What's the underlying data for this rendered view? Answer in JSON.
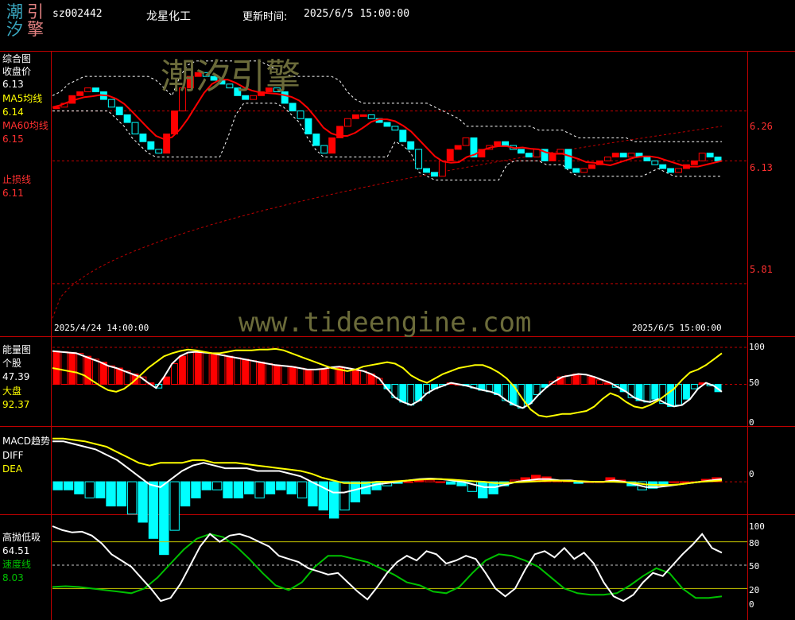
{
  "header": {
    "logo_chars": [
      "潮",
      "引",
      "汐",
      "擎"
    ],
    "code": "sz002442",
    "name": "龙星化工",
    "update_label": "更新时间:",
    "update_time": "2025/6/5 15:00:00"
  },
  "watermarks": {
    "brand": "潮汐引擎",
    "url": "www.tideengine.com"
  },
  "colors": {
    "background": "#000000",
    "border": "#c00000",
    "up": "#ff0000",
    "down": "#00ffff",
    "yellow": "#ffff00",
    "green": "#00c000"
  },
  "chart_data": [
    {
      "id": "composite",
      "type": "candlestick",
      "title": "综合图",
      "labels": {
        "close_label": "收盘价",
        "close_value": "6.13",
        "ma5_label": "MA5均线",
        "ma5_value": "6.14",
        "ma60_label": "MA60均线",
        "ma60_value": "6.15",
        "stop_label": "止损线",
        "stop_value": "6.11"
      },
      "date_start": "2025/4/24 14:00:00",
      "date_end": "2025/6/5 15:00:00",
      "y_ticks": [
        "6.26",
        "6.13",
        "5.81"
      ],
      "ylim": [
        5.7,
        6.4
      ],
      "closes": [
        6.27,
        6.28,
        6.3,
        6.31,
        6.32,
        6.31,
        6.29,
        6.27,
        6.25,
        6.23,
        6.2,
        6.18,
        6.16,
        6.15,
        6.2,
        6.26,
        6.32,
        6.35,
        6.36,
        6.35,
        6.34,
        6.33,
        6.32,
        6.3,
        6.29,
        6.3,
        6.31,
        6.32,
        6.31,
        6.28,
        6.26,
        6.24,
        6.2,
        6.17,
        6.15,
        6.19,
        6.22,
        6.24,
        6.25,
        6.25,
        6.24,
        6.23,
        6.22,
        6.21,
        6.18,
        6.16,
        6.11,
        6.1,
        6.09,
        6.13,
        6.16,
        6.17,
        6.19,
        6.14,
        6.16,
        6.17,
        6.18,
        6.17,
        6.16,
        6.15,
        6.14,
        6.16,
        6.13,
        6.15,
        6.16,
        6.11,
        6.1,
        6.11,
        6.12,
        6.13,
        6.14,
        6.15,
        6.14,
        6.15,
        6.14,
        6.13,
        6.12,
        6.11,
        6.1,
        6.11,
        6.12,
        6.13,
        6.15,
        6.14,
        6.13
      ]
    },
    {
      "id": "energy",
      "type": "bar+line",
      "title": "能量图",
      "stock_label": "个股",
      "stock_value": "47.39",
      "market_label": "大盘",
      "market_value": "92.37",
      "y_ticks": [
        "100",
        "50",
        "0"
      ],
      "ylim": [
        0,
        100
      ],
      "series": [
        {
          "name": "个股",
          "values": [
            95,
            94,
            93,
            92,
            88,
            84,
            80,
            75,
            72,
            68,
            64,
            60,
            52,
            45,
            60,
            78,
            88,
            93,
            94,
            93,
            92,
            90,
            88,
            86,
            84,
            82,
            80,
            78,
            76,
            75,
            74,
            72,
            70,
            70,
            71,
            73,
            74,
            72,
            70,
            68,
            64,
            58,
            44,
            32,
            26,
            22,
            28,
            38,
            44,
            48,
            52,
            50,
            48,
            45,
            42,
            40,
            36,
            28,
            22,
            18,
            24,
            36,
            46,
            54,
            60,
            62,
            64,
            63,
            60,
            56,
            52,
            46,
            40,
            32,
            28,
            26,
            30,
            24,
            20,
            22,
            30,
            44,
            52,
            48,
            40
          ]
        },
        {
          "name": "大盘",
          "values": [
            72,
            70,
            68,
            66,
            62,
            55,
            48,
            42,
            40,
            44,
            52,
            62,
            72,
            80,
            88,
            92,
            95,
            97,
            96,
            94,
            92,
            92,
            94,
            96,
            96,
            96,
            97,
            97,
            98,
            96,
            92,
            88,
            84,
            80,
            76,
            72,
            70,
            68,
            70,
            74,
            76,
            78,
            80,
            78,
            72,
            62,
            56,
            52,
            58,
            64,
            68,
            72,
            74,
            76,
            76,
            72,
            66,
            58,
            46,
            30,
            16,
            8,
            6,
            8,
            10,
            10,
            12,
            14,
            20,
            30,
            38,
            34,
            26,
            20,
            18,
            22,
            28,
            36,
            44,
            56,
            66,
            70,
            76,
            84,
            92
          ]
        }
      ]
    },
    {
      "id": "macd",
      "type": "bar+line",
      "title": "MACD趋势",
      "diff_label": "DIFF",
      "dea_label": "DEA",
      "y_ticks": [
        "0"
      ],
      "ylim": [
        -0.1,
        0.18
      ],
      "series": [
        {
          "name": "DIFF",
          "values": [
            0.15,
            0.15,
            0.14,
            0.13,
            0.12,
            0.1,
            0.08,
            0.05,
            0.02,
            -0.01,
            -0.02,
            0.01,
            0.04,
            0.06,
            0.07,
            0.06,
            0.05,
            0.05,
            0.05,
            0.04,
            0.04,
            0.04,
            0.03,
            0.02,
            0.0,
            -0.02,
            -0.04,
            -0.04,
            -0.03,
            -0.02,
            -0.01,
            -0.005,
            0.0,
            0.005,
            0.01,
            0.012,
            0.01,
            0.005,
            0.0,
            -0.01,
            -0.02,
            -0.02,
            -0.01,
            0.0,
            0.005,
            0.01,
            0.01,
            0.005,
            0.005,
            0.0,
            0.0,
            0.0,
            0.005,
            0.0,
            -0.01,
            -0.02,
            -0.02,
            -0.015,
            -0.01,
            -0.005,
            0.0,
            0.005,
            0.01
          ]
        },
        {
          "name": "DEA",
          "values": [
            0.16,
            0.16,
            0.155,
            0.15,
            0.14,
            0.13,
            0.11,
            0.09,
            0.07,
            0.06,
            0.07,
            0.07,
            0.07,
            0.08,
            0.08,
            0.07,
            0.07,
            0.07,
            0.065,
            0.06,
            0.055,
            0.05,
            0.045,
            0.04,
            0.03,
            0.015,
            0.005,
            -0.005,
            -0.005,
            -0.005,
            0.0,
            0.0,
            0.002,
            0.005,
            0.008,
            0.01,
            0.01,
            0.008,
            0.005,
            0.002,
            0.0,
            -0.005,
            -0.005,
            -0.002,
            0.0,
            0.002,
            0.004,
            0.004,
            0.003,
            0.002,
            0.0,
            0.0,
            0.0,
            -0.002,
            -0.005,
            -0.01,
            -0.012,
            -0.012,
            -0.01,
            -0.005,
            0.0,
            0.002,
            0.005
          ]
        }
      ]
    },
    {
      "id": "oscillator",
      "type": "line",
      "title": "高抛低吸",
      "value": "64.51",
      "speed_label": "速度线",
      "speed_value": "8.03",
      "y_ticks": [
        "100",
        "80",
        "50",
        "20",
        "0"
      ],
      "ylim": [
        0,
        100
      ],
      "series": [
        {
          "name": "高抛低吸",
          "values": [
            100,
            95,
            92,
            93,
            88,
            78,
            64,
            56,
            48,
            34,
            20,
            4,
            8,
            26,
            50,
            74,
            90,
            80,
            88,
            90,
            86,
            80,
            74,
            62,
            58,
            54,
            46,
            42,
            38,
            40,
            28,
            16,
            6,
            22,
            40,
            54,
            62,
            56,
            68,
            64,
            52,
            56,
            62,
            58,
            40,
            20,
            10,
            20,
            44,
            64,
            68,
            60,
            72,
            58,
            66,
            52,
            28,
            10,
            4,
            12,
            28,
            40,
            36,
            50,
            64,
            76,
            90,
            72,
            66
          ]
        },
        {
          "name": "速度线",
          "values": [
            22,
            23,
            22,
            20,
            18,
            16,
            14,
            20,
            34,
            52,
            70,
            84,
            90,
            86,
            74,
            58,
            40,
            24,
            18,
            28,
            48,
            62,
            62,
            58,
            54,
            46,
            38,
            28,
            24,
            16,
            14,
            22,
            40,
            56,
            64,
            62,
            56,
            48,
            34,
            20,
            14,
            12,
            12,
            14,
            24,
            36,
            46,
            40,
            20,
            8,
            8,
            10
          ]
        }
      ]
    }
  ]
}
